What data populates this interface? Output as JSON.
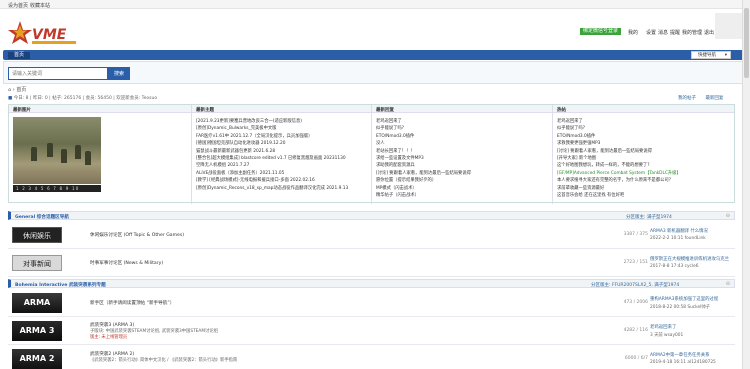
{
  "topbar": {
    "set_home": "设为首页",
    "bookmark": "收藏本站"
  },
  "header": {
    "site_logo_text": "VME",
    "bind_wechat": "绑定微信号登录",
    "user_links": [
      "我的",
      "设置",
      "消息",
      "提醒",
      "我的管理",
      "退出"
    ]
  },
  "nav": {
    "home": "首页",
    "quick": "快捷导航"
  },
  "search": {
    "placeholder": "请输入关键词",
    "button": "搜索"
  },
  "breadcrumb": "首页",
  "stats": {
    "text": "今日: 8 | 昨日: 0 | 帖子: 265176 | 会员: 56450 | 欢迎新会员: Teosuo",
    "links": [
      "我的帖子",
      "最新回复"
    ]
  },
  "hot": {
    "columns": [
      "最新图片",
      "最新主题",
      "最新回复",
      "热帖"
    ],
    "image_pages": "1 2 3 4 5 6 7 8 9 10",
    "latest_topics": [
      "[2021.9.23更新]要塞兵营地改良三合一(适应新版信息)",
      "[原创]Dynamic_Bulwarks_完美极中文版",
      "FAR医疗v1.61中 2021.12.7（全局汉化提示，兵员加强版）",
      "[德国]德国坦克部队自动化进攻器 2019.12.20",
      "猫鼠战斗最新最新武器包更新 2021.6.28",
      "[整合包]超大模组集成] blastcore edited v1.7 已修复黑烟及画面 20231130",
      "空降无人机模组 2021.7.27",
      "ALiVE战役面板（添加主副任务）2021.11.05",
      "[教学] [经典战场模式]-无线电报和援兵接口-多面 2022.02.16",
      "[原创]Dynamic_Recons_v18_sp_map动态战役作品翻译汉化完成 2021.9.13"
    ],
    "latest_replies": [
      "老鸡返回来了",
      "似乎能说了吗?",
      "ETO/Nmod3.0插件",
      "没人",
      "老站长回来了！！！",
      "求给一些设置及文件MP3",
      "求助我的配套资源兵",
      "[讨论] 要跟着人家看，能到达最后一些结局要说得",
      "愿你位置（提示结果我好歹的）",
      "MP模式（闪击战术）",
      "精华帖子（闪击战术）"
    ],
    "hot_threads": [
      "老鸡返回来了",
      "似乎能说了吗?",
      "ETO/Nmod3.0插件",
      "求救我要更强更强MP3",
      "[讨论] 要跟着人家看，能到达最后一些结局要说得",
      "[开导大家] 新个地图",
      "这个好地图我想玩，转成一样的，不能的想要了?",
      "[GF/MP]Advanced Pierce Combat System【TankDLC升级】",
      "本人要求搜寻大家还有完整的名字，为什么原来不是都公司？",
      "求前辈收藏一些资源最好",
      "这首音乐会给 还在这里找 有位好吧"
    ]
  },
  "sections": [
    {
      "title": "General 综合话题区导航",
      "moderator": "分区版主: 满子型1974",
      "forums": [
        {
          "icon": "休闲娱乐",
          "name": "休闲娱乐讨论区 (Off Topic & Other Games)",
          "count": "3387 / 375",
          "last1": "ARMA3 新机器翻译 什么情况",
          "last2": "2022-2-2 10:11 foundLink"
        },
        {
          "icon": "对事新闻",
          "name": "时事军事讨论区 (News & Military)",
          "count": "2723 / 151",
          "last1": "俄罗斯正在大规模推进训练机进攻乌克兰",
          "last2": "2017-8-8 17:43 cycle6"
        }
      ]
    },
    {
      "title": "Bohemia Interactive 武装突袭系列专题",
      "moderator": "分区版主: FFUR2007SLX2_5, 满子型1974",
      "forums": [
        {
          "icon": "ARMA",
          "name": "新手区（新手请阅读置顶帖 “新手导航”）",
          "count": "473 / 2006",
          "last1": "重构ARMA3系统加强了这里的过程",
          "last2": "2018-8-22 00:58 Suckel帅子"
        },
        {
          "icon": "ARMA 3",
          "name": "武装突袭3 (ARMA 3)",
          "sub": "子版块: 中国武装突袭STEAM讨论组, 武装突袭3中国STEAM讨论组",
          "sub2": "版主: 未上线管理员",
          "count": "4282 / 116",
          "last1": "老鸡返回来了",
          "last2": "3 天前 wsay001"
        },
        {
          "icon": "ARMA 2",
          "name": "武装突袭2 (ARMA 2)",
          "sub": "《武装突袭2：箭头行动》简体中文汉化 / 《武装突袭2：箭头行动》新手指南",
          "count": "6000 / 6/7",
          "last1": "ARMA2中第一章任务任务关系",
          "last2": "2019-4-18 16:11 al124180725"
        }
      ]
    }
  ]
}
